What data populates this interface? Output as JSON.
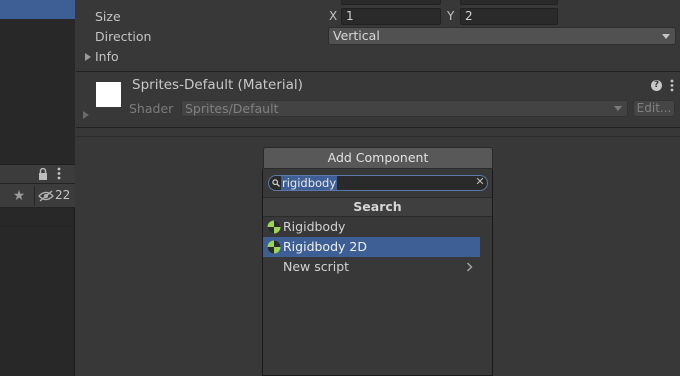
{
  "hierarchy": {
    "eye_count": "22"
  },
  "inspector": {
    "size_label": "Size",
    "size_x_label": "X",
    "size_x_value": "1",
    "size_y_label": "Y",
    "size_y_value": "2",
    "direction_label": "Direction",
    "direction_value": "Vertical",
    "info_label": "Info"
  },
  "material": {
    "title": "Sprites-Default (Material)",
    "shader_label": "Shader",
    "shader_value": "Sprites/Default",
    "edit_label": "Edit..."
  },
  "add_component": {
    "button_label": "Add Component",
    "search_value": "rigidbody",
    "section_header": "Search",
    "results": [
      {
        "label": "Rigidbody",
        "icon": "rigidbody-icon",
        "selected": false
      },
      {
        "label": "Rigidbody 2D",
        "icon": "rigidbody-icon",
        "selected": true
      },
      {
        "label": "New script",
        "icon": "chevron-right-icon",
        "selected": false
      }
    ]
  },
  "colors": {
    "selection": "#3e5f96",
    "panel_bg": "#383838",
    "dark_bg": "#282828"
  }
}
